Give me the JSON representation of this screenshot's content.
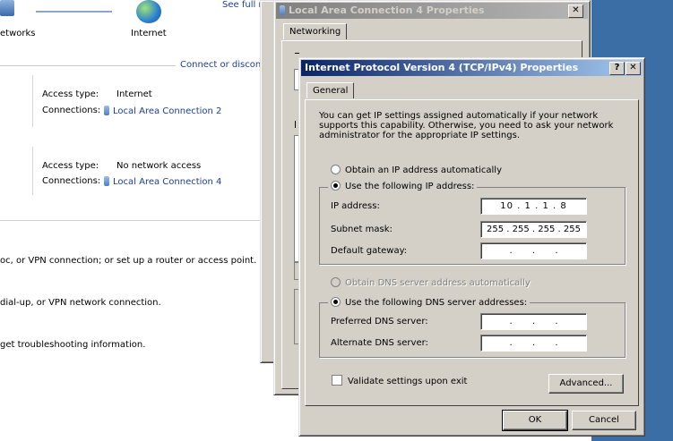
{
  "nsc": {
    "see_full_map": "See full m",
    "networks_label": "etworks",
    "internet_label": "Internet",
    "connect_disconnect": "Connect or disconn",
    "net1": {
      "access_label": "Access type:",
      "access_value": "Internet",
      "conn_label": "Connections:",
      "conn_value": "Local Area Connection 2"
    },
    "net2": {
      "access_label": "Access type:",
      "access_value": "No network access",
      "conn_label": "Connections:",
      "conn_value": "Local Area Connection 4"
    },
    "task1": "oc, or VPN connection; or set up a router or access point.",
    "task2": "dial-up, or VPN network connection.",
    "task3": "get troubleshooting information."
  },
  "lac_dialog": {
    "title": "Local Area Connection 4 Properties",
    "close": "✕",
    "tab": "Networking"
  },
  "ipv4_dialog": {
    "title": "Internet Protocol Version 4 (TCP/IPv4) Properties",
    "help_btn": "?",
    "close_btn": "✕",
    "tab": "General",
    "intro": "You can get IP settings assigned automatically if your network supports this capability. Otherwise, you need to ask your network administrator for the appropriate IP settings.",
    "obtain_ip": "Obtain an IP address automatically",
    "use_ip": "Use the following IP address:",
    "ip_label": "IP address:",
    "ip_value": "10 .  1  .  1  .  8",
    "subnet_label": "Subnet mask:",
    "subnet_value": "255 . 255 . 255 . 255",
    "gateway_label": "Default gateway:",
    "gateway_value": ".       .       .",
    "obtain_dns": "Obtain DNS server address automatically",
    "use_dns": "Use the following DNS server addresses:",
    "pref_dns_label": "Preferred DNS server:",
    "pref_dns_value": ".       .       .",
    "alt_dns_label": "Alternate DNS server:",
    "alt_dns_value": ".       .       .",
    "validate": "Validate settings upon exit",
    "advanced": "Advanced...",
    "ok": "OK",
    "cancel": "Cancel"
  }
}
